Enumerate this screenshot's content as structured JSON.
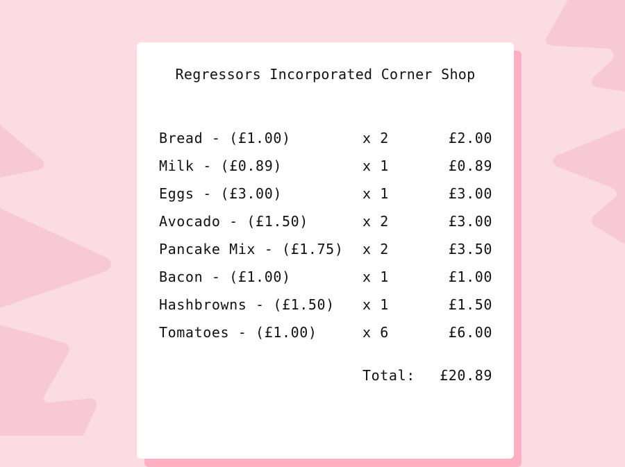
{
  "shop": {
    "title": "Regressors Incorporated Corner Shop"
  },
  "items": [
    {
      "name": "Bread - (£1.00)",
      "qty": "x 2",
      "total": "£2.00"
    },
    {
      "name": "Milk - (£0.89)",
      "qty": "x 1",
      "total": "£0.89"
    },
    {
      "name": "Eggs - (£3.00)",
      "qty": "x 1",
      "total": "£3.00"
    },
    {
      "name": "Avocado - (£1.50)",
      "qty": "x 2",
      "total": "£3.00"
    },
    {
      "name": "Pancake Mix - (£1.75)",
      "qty": "x 2",
      "total": "£3.50"
    },
    {
      "name": "Bacon - (£1.00)",
      "qty": "x 1",
      "total": "£1.00"
    },
    {
      "name": "Hashbrowns - (£1.50)",
      "qty": "x 1",
      "total": "£1.50"
    },
    {
      "name": "Tomatoes - (£1.00)",
      "qty": "x 6",
      "total": "£6.00"
    }
  ],
  "summary": {
    "total_label": "Total:",
    "total_value": "£20.89"
  },
  "colors": {
    "background": "#fcdce3",
    "background_shape": "#f6c9d4",
    "receipt": "#ffffff",
    "receipt_shadow": "#ffafc2",
    "text": "#111111"
  }
}
